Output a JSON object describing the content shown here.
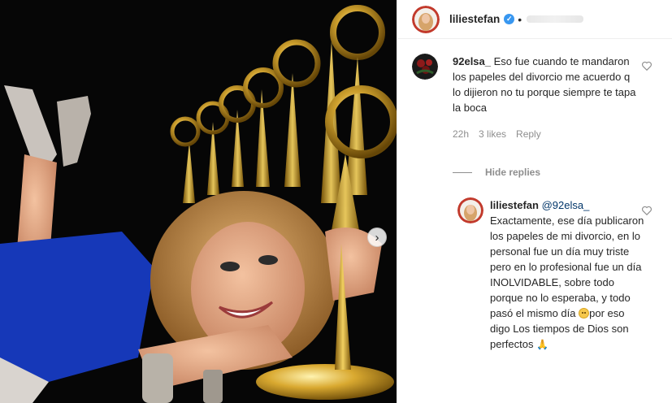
{
  "post": {
    "username": "liliestefan",
    "verified_icon": "verified-badge-icon",
    "separator": "•"
  },
  "comment": {
    "username": "92elsa_",
    "text": "Eso fue cuando te mandaron los papeles del divorcio me acuerdo q lo dijieron no tu porque siempre te tapa la boca",
    "time": "22h",
    "likes": "3 likes",
    "reply_label": "Reply"
  },
  "replies_toggle": {
    "label": "Hide replies"
  },
  "reply": {
    "username": "liliestefan",
    "mention": "@92elsa_",
    "text_part1": "Exactamente, ese día publicaron los papeles de mi divorcio, en lo personal fue un día muy triste pero en lo profesional fue un día INOLVIDABLE, sobre todo porque no lo esperaba, y todo pasó el mismo día",
    "text_part2": "por eso digo Los tiempos de Dios son perfectos",
    "emoji_1": "slightly-frowning-face-emoji",
    "emoji_2": "🙏"
  },
  "carousel": {
    "next_glyph": "›"
  },
  "colors": {
    "verified": "#3897f0",
    "secondary_text": "#8e8e8e",
    "mention": "#003569"
  }
}
